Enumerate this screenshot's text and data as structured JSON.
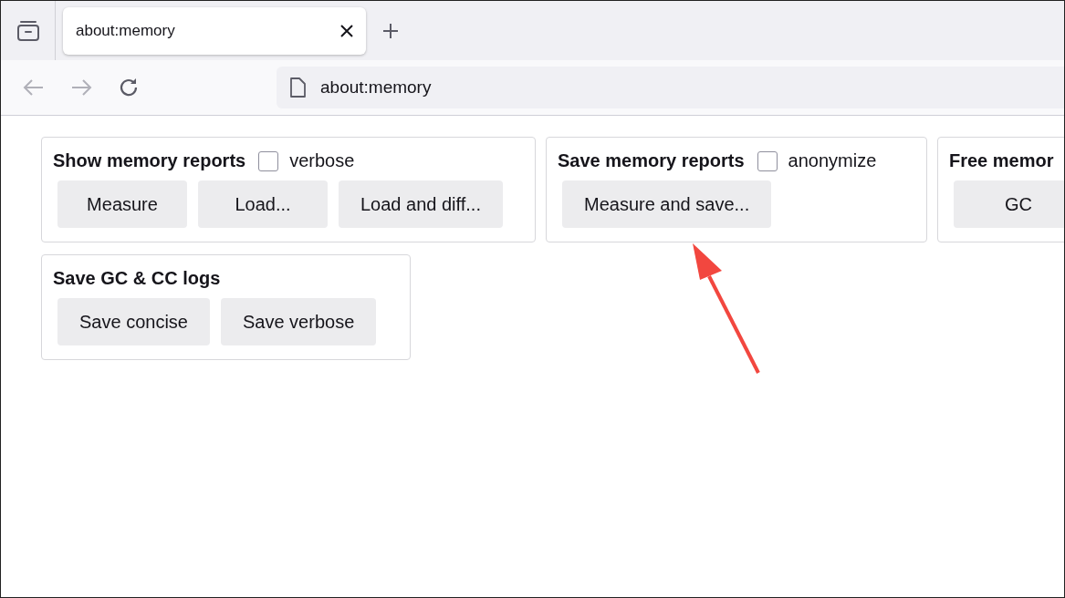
{
  "tabs": [
    {
      "title": "about:memory",
      "selected": true
    }
  ],
  "address_bar": {
    "value": "about:memory"
  },
  "sections": [
    {
      "title": "Show memory reports",
      "option": {
        "label": "verbose",
        "checked": false
      },
      "buttons": [
        "Measure",
        "Load...",
        "Load and diff..."
      ]
    },
    {
      "title": "Save memory reports",
      "option": {
        "label": "anonymize",
        "checked": false
      },
      "buttons": [
        "Measure and save..."
      ]
    },
    {
      "title": "Free memor",
      "buttons": [
        "GC"
      ]
    },
    {
      "title": "Save GC & CC logs",
      "buttons": [
        "Save concise",
        "Save verbose"
      ]
    }
  ]
}
